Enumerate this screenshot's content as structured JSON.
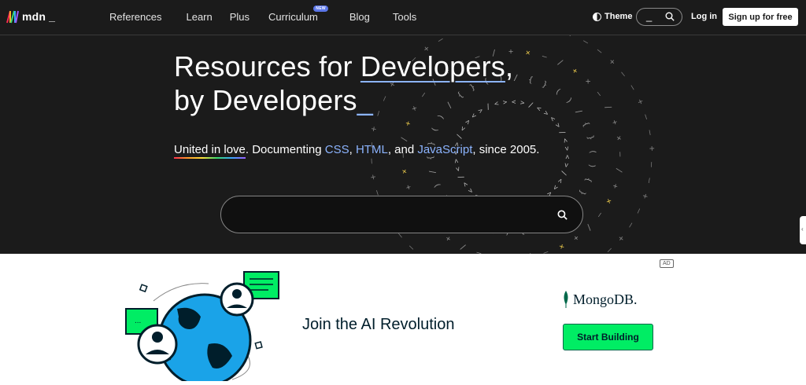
{
  "header": {
    "logo_text": "mdn",
    "logo_suffix": "_",
    "nav": [
      {
        "label": "References"
      },
      {
        "label": "Learn"
      },
      {
        "label": "Plus"
      },
      {
        "label": "Curriculum",
        "badge": "NEW"
      },
      {
        "label": "Blog"
      },
      {
        "label": "Tools"
      }
    ],
    "theme_label": "Theme",
    "search_shortcut": "_",
    "login_label": "Log in",
    "signup_label": "Sign up for free"
  },
  "hero": {
    "title_line1_prefix": "Resources for ",
    "title_line1_highlight": "Developers",
    "title_line1_suffix": ",",
    "title_line2": "by Developers",
    "title_cursor": "_",
    "sub_rainbow": "United in love",
    "sub_text1": ". Documenting ",
    "sub_css": "CSS",
    "sub_comma1": ", ",
    "sub_html": "HTML",
    "sub_and": ", and ",
    "sub_js": "JavaScript",
    "sub_end": ", since 2005.",
    "search_placeholder": ""
  },
  "ad": {
    "label": "AD",
    "headline": "Join the AI Revolution",
    "brand": "MongoDB.",
    "cta_label": "Start Building",
    "chat_dots": "..."
  },
  "colors": {
    "header_bg": "#1b1b1b",
    "link": "#8cb4ff",
    "cta_green": "#00ed64",
    "brand_dark": "#001e2b"
  }
}
